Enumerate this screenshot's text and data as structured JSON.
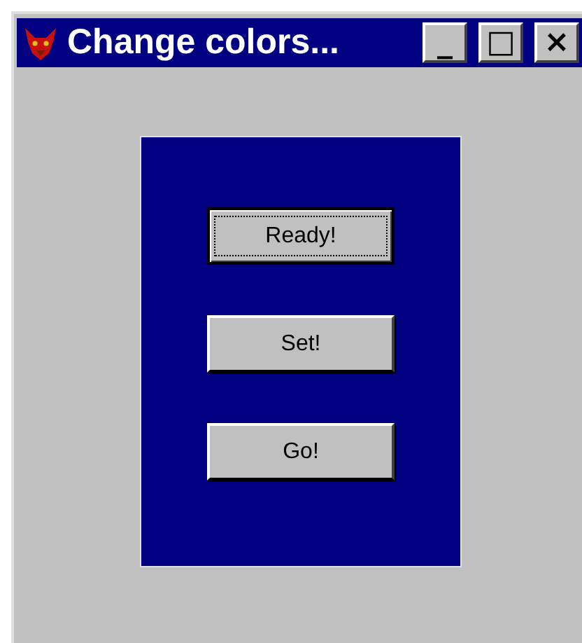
{
  "window": {
    "title": "Change colors..."
  },
  "title_buttons": [
    {
      "label": "_"
    },
    {
      "label": "□"
    },
    {
      "label": "×"
    }
  ],
  "buttons": [
    {
      "label": "Ready!",
      "focused": true
    },
    {
      "label": "Set!",
      "focused": false
    },
    {
      "label": "Go!",
      "focused": false
    }
  ]
}
